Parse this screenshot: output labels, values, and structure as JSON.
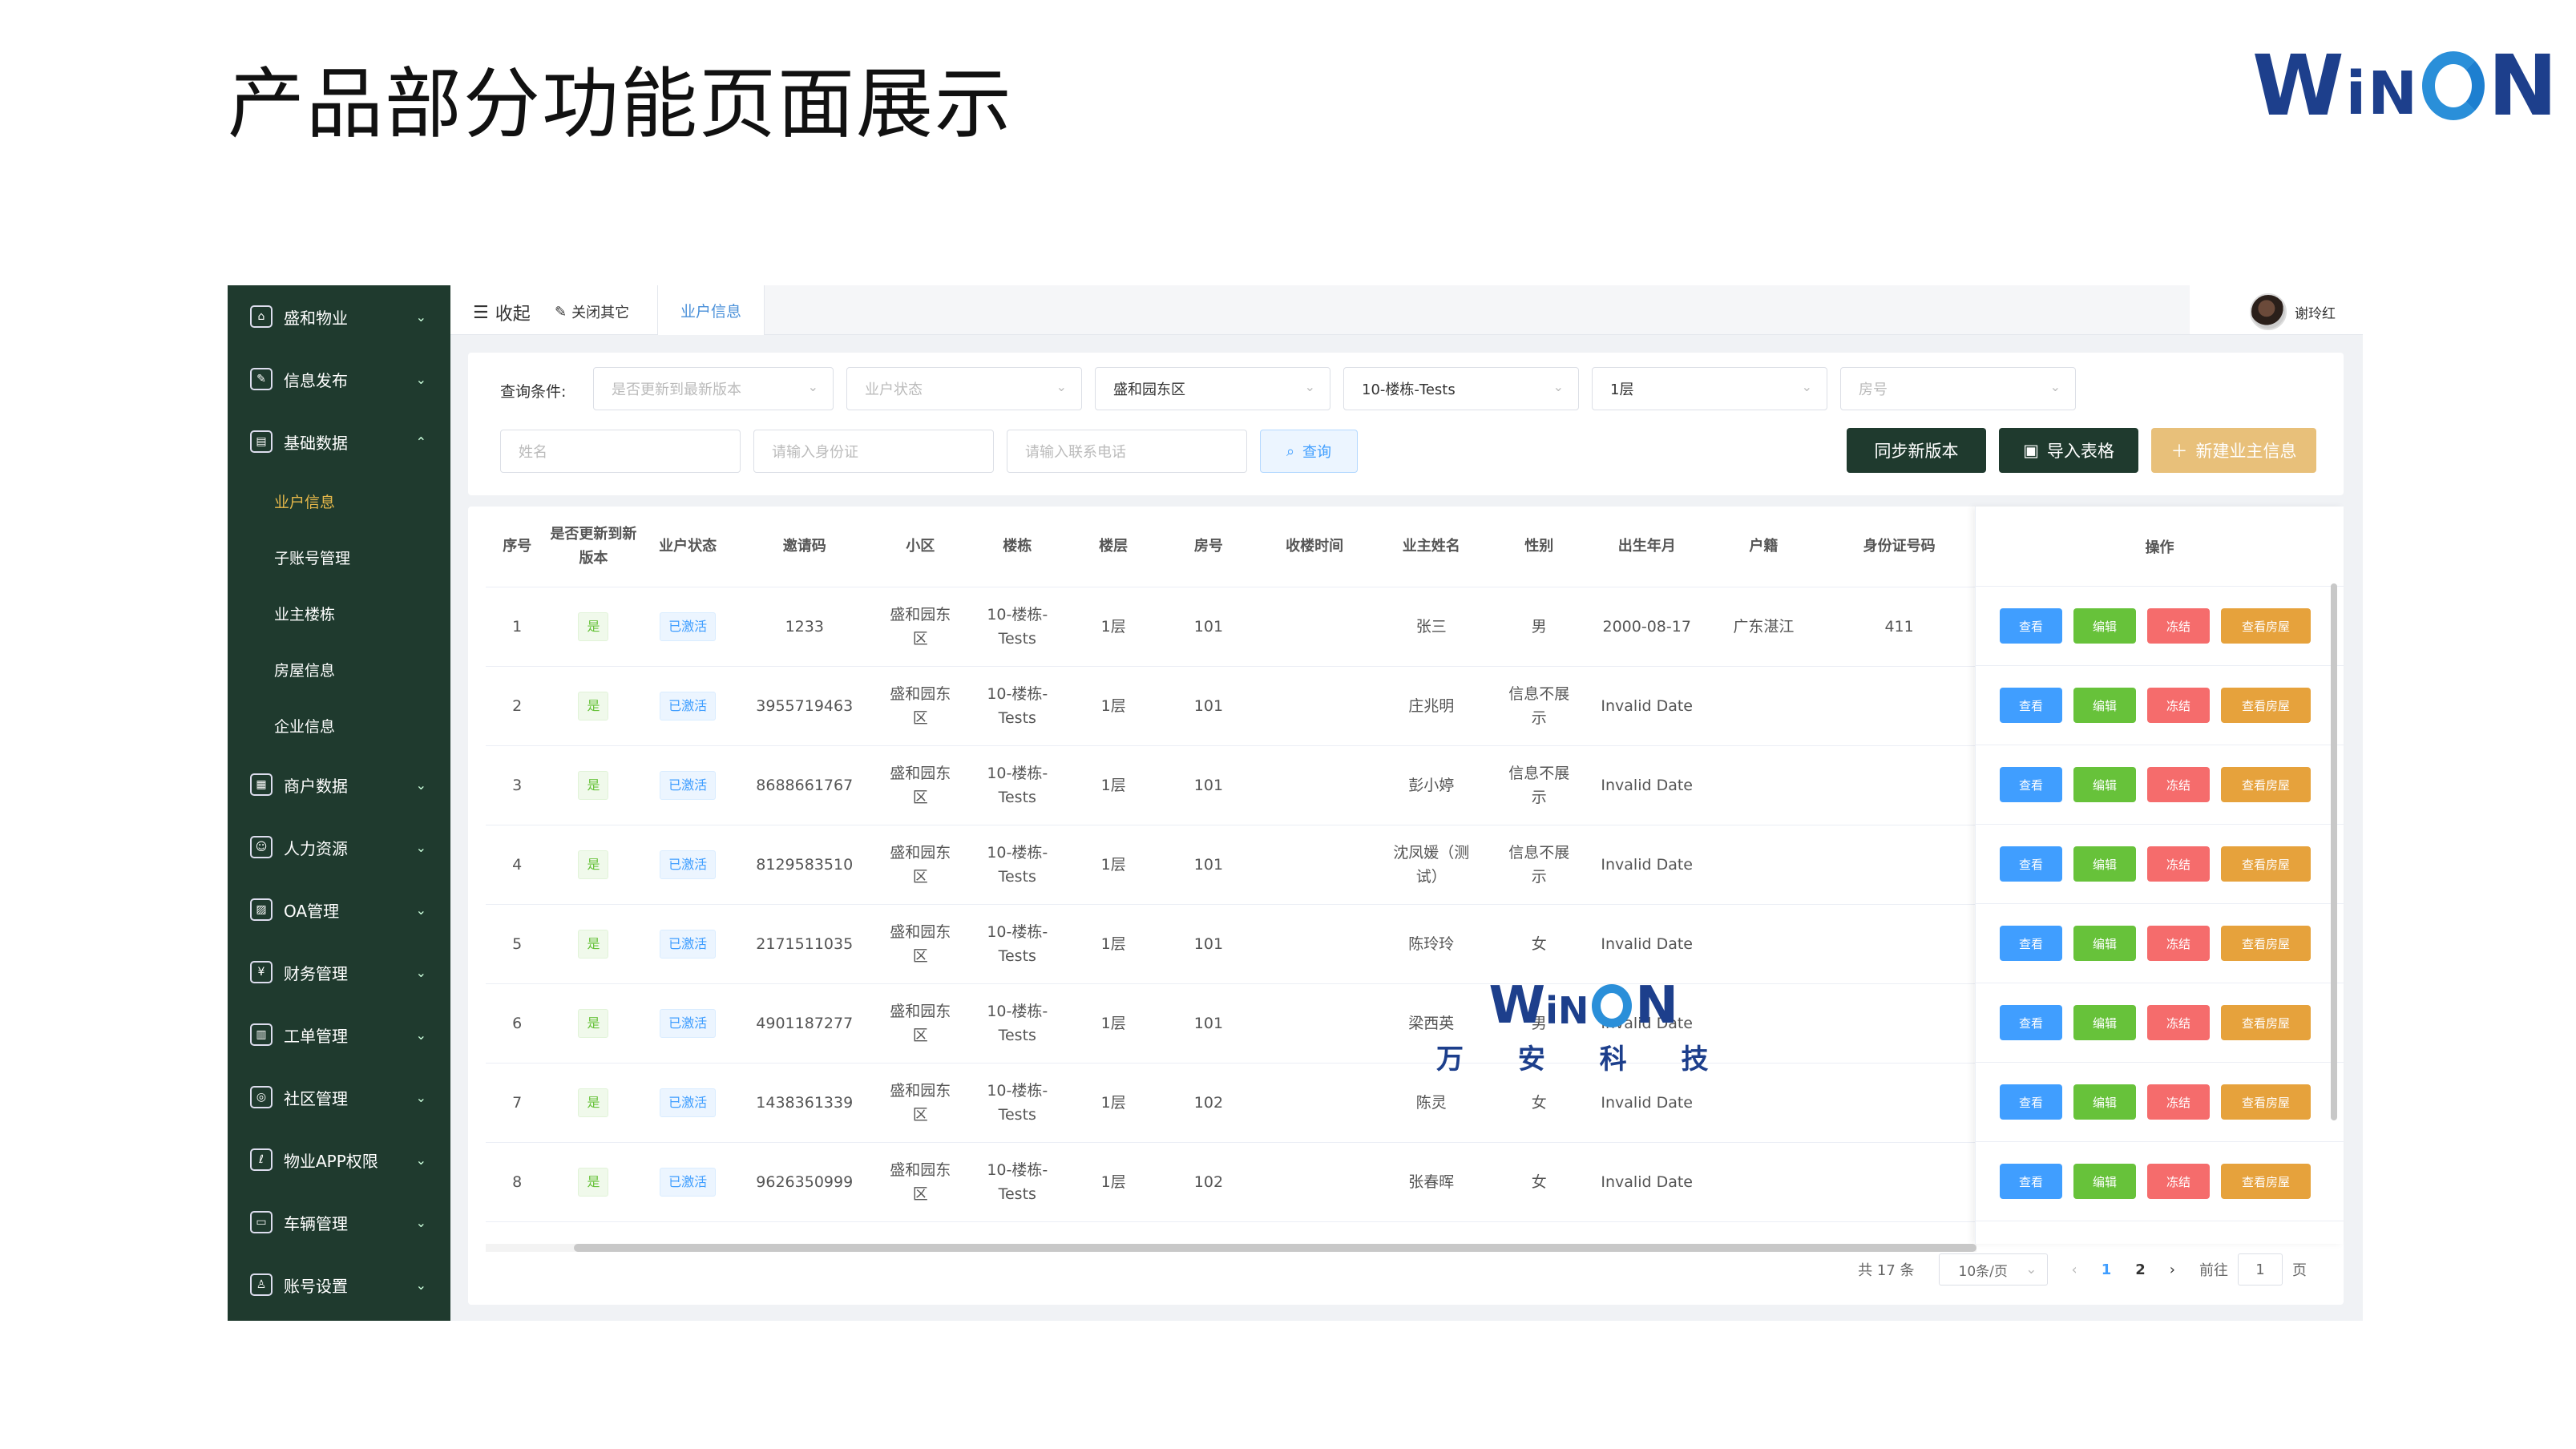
{
  "slide": {
    "title": "产品部分功能页面展示"
  },
  "brand": {
    "logo_text": "WiNON",
    "colors": {
      "primary": "#1d3f8c",
      "accent": "#2a8fd9"
    }
  },
  "watermark": {
    "logo_text": "WiNON",
    "subtitle": "万 安 科 技"
  },
  "sidebar": {
    "bg_color": "#1f3a2e",
    "items": [
      {
        "label": "盛和物业",
        "icon": "home-icon",
        "expanded": false
      },
      {
        "label": "信息发布",
        "icon": "edit-icon",
        "expanded": false
      },
      {
        "label": "基础数据",
        "icon": "database-icon",
        "expanded": true,
        "children": [
          {
            "label": "业户信息",
            "active": true
          },
          {
            "label": "子账号管理"
          },
          {
            "label": "业主楼栋"
          },
          {
            "label": "房屋信息"
          },
          {
            "label": "企业信息"
          }
        ]
      },
      {
        "label": "商户数据",
        "icon": "store-icon",
        "expanded": false
      },
      {
        "label": "人力资源",
        "icon": "user-group-icon",
        "expanded": false
      },
      {
        "label": "OA管理",
        "icon": "image-icon",
        "expanded": false
      },
      {
        "label": "财务管理",
        "icon": "finance-icon",
        "expanded": false
      },
      {
        "label": "工单管理",
        "icon": "clipboard-icon",
        "expanded": false
      },
      {
        "label": "社区管理",
        "icon": "community-icon",
        "expanded": false
      },
      {
        "label": "物业APP权限",
        "icon": "permission-icon",
        "expanded": false
      },
      {
        "label": "车辆管理",
        "icon": "car-icon",
        "expanded": false
      },
      {
        "label": "账号设置",
        "icon": "user-icon",
        "expanded": false
      }
    ]
  },
  "topbar": {
    "collapse_label": "收起",
    "close_other_label": "关闭其它",
    "active_tab": "业户信息",
    "user_name": "谢玲红"
  },
  "filters": {
    "label": "查询条件:",
    "version_placeholder": "是否更新到最新版本",
    "status_placeholder": "业户状态",
    "community_value": "盛和园东区",
    "building_value": "10-楼栋-Tests",
    "floor_value": "1层",
    "room_placeholder": "房号",
    "name_placeholder": "姓名",
    "idcard_placeholder": "请输入身份证",
    "phone_placeholder": "请输入联系电话",
    "search_label": "查询",
    "sync_label": "同步新版本",
    "import_label": "导入表格",
    "new_label": "新建业主信息"
  },
  "table": {
    "headers": [
      "序号",
      "是否更新到新版本",
      "业户状态",
      "邀请码",
      "小区",
      "楼栋",
      "楼层",
      "房号",
      "收楼时间",
      "业主姓名",
      "性别",
      "出生年月",
      "户籍",
      "身份证号码"
    ],
    "ops_header": "操作",
    "ops_labels": {
      "view": "查看",
      "edit": "编辑",
      "freeze": "冻结",
      "house": "查看房屋"
    },
    "rows": [
      {
        "no": "1",
        "updated": "是",
        "status": "已激活",
        "code": "1233",
        "community": "盛和园东区",
        "building": "10-楼栋-Tests",
        "floor": "1层",
        "room": "101",
        "recv": "",
        "name": "张三",
        "gender": "男",
        "birth": "2000-08-17",
        "huji": "广东湛江",
        "idcard": "411"
      },
      {
        "no": "2",
        "updated": "是",
        "status": "已激活",
        "code": "3955719463",
        "community": "盛和园东区",
        "building": "10-楼栋-Tests",
        "floor": "1层",
        "room": "101",
        "recv": "",
        "name": "庄兆明",
        "gender": "信息不展示",
        "birth": "Invalid Date",
        "huji": "",
        "idcard": ""
      },
      {
        "no": "3",
        "updated": "是",
        "status": "已激活",
        "code": "8688661767",
        "community": "盛和园东区",
        "building": "10-楼栋-Tests",
        "floor": "1层",
        "room": "101",
        "recv": "",
        "name": "彭小婷",
        "gender": "信息不展示",
        "birth": "Invalid Date",
        "huji": "",
        "idcard": ""
      },
      {
        "no": "4",
        "updated": "是",
        "status": "已激活",
        "code": "8129583510",
        "community": "盛和园东区",
        "building": "10-楼栋-Tests",
        "floor": "1层",
        "room": "101",
        "recv": "",
        "name": "沈凤媛（测试）",
        "gender": "信息不展示",
        "birth": "Invalid Date",
        "huji": "",
        "idcard": ""
      },
      {
        "no": "5",
        "updated": "是",
        "status": "已激活",
        "code": "2171511035",
        "community": "盛和园东区",
        "building": "10-楼栋-Tests",
        "floor": "1层",
        "room": "101",
        "recv": "",
        "name": "陈玲玲",
        "gender": "女",
        "birth": "Invalid Date",
        "huji": "",
        "idcard": ""
      },
      {
        "no": "6",
        "updated": "是",
        "status": "已激活",
        "code": "4901187277",
        "community": "盛和园东区",
        "building": "10-楼栋-Tests",
        "floor": "1层",
        "room": "101",
        "recv": "",
        "name": "梁西英",
        "gender": "男",
        "birth": "Invalid Date",
        "huji": "",
        "idcard": ""
      },
      {
        "no": "7",
        "updated": "是",
        "status": "已激活",
        "code": "1438361339",
        "community": "盛和园东区",
        "building": "10-楼栋-Tests",
        "floor": "1层",
        "room": "102",
        "recv": "",
        "name": "陈灵",
        "gender": "女",
        "birth": "Invalid Date",
        "huji": "",
        "idcard": ""
      },
      {
        "no": "8",
        "updated": "是",
        "status": "已激活",
        "code": "9626350999",
        "community": "盛和园东区",
        "building": "10-楼栋-Tests",
        "floor": "1层",
        "room": "102",
        "recv": "",
        "name": "张春晖",
        "gender": "女",
        "birth": "Invalid Date",
        "huji": "",
        "idcard": ""
      }
    ]
  },
  "pagination": {
    "total_label": "共 17 条",
    "page_size": "10条/页",
    "pages": [
      "1",
      "2"
    ],
    "current": "1",
    "goto_label": "前往",
    "goto_value": "1",
    "page_unit": "页"
  }
}
